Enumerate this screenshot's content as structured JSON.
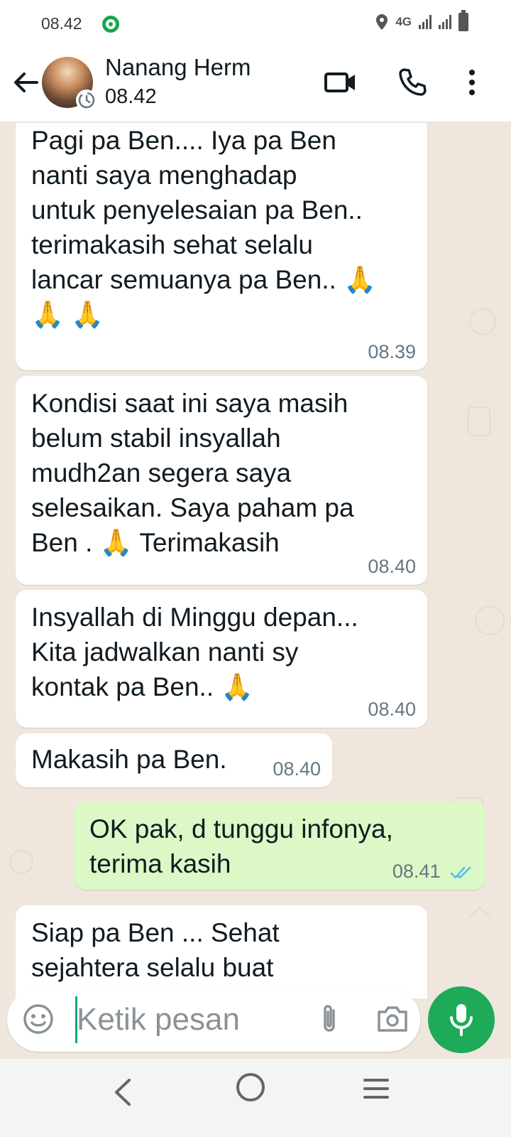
{
  "status_bar": {
    "time": "08.42",
    "network": "4G"
  },
  "header": {
    "contact_name": "Nanang Herm",
    "status": "08.42"
  },
  "messages": [
    {
      "direction": "in",
      "text": "Pagi pa Ben.... Iya pa Ben\nnanti saya menghadap\nuntuk penyelesaian pa Ben..\nterimakasih sehat selalu\nlancar semuanya pa Ben.. 🙏\n🙏 🙏",
      "time": "08.39"
    },
    {
      "direction": "in",
      "text": "Kondisi saat ini saya masih\nbelum stabil insyallah\nmudh2an segera saya\nselesaikan. Saya paham pa\nBen . 🙏 Terimakasih",
      "time": "08.40"
    },
    {
      "direction": "in",
      "text": "Insyallah di Minggu depan...\nKita jadwalkan nanti sy\nkontak pa Ben.. 🙏",
      "time": "08.40"
    },
    {
      "direction": "in",
      "text": "Makasih pa Ben.",
      "time": "08.40"
    },
    {
      "direction": "out",
      "text": "OK pak, d tunggu infonya,\nterima kasih",
      "time": "08.41",
      "status": "read"
    },
    {
      "direction": "in",
      "text": "Siap pa Ben ... Sehat\nsejahtera selalu buat",
      "time": ""
    }
  ],
  "composer": {
    "placeholder": "Ketik pesan",
    "value": ""
  },
  "colors": {
    "accent": "#1eaa58",
    "chat_background": "#efe7dd",
    "outgoing_bubble": "#dcf8c6",
    "incoming_bubble": "#ffffff",
    "read_tick": "#53bdeb"
  },
  "icons": {
    "back": "arrow-left-icon",
    "video": "video-camera-icon",
    "call": "phone-icon",
    "menu": "more-vert-icon",
    "emoji": "smiley-icon",
    "attach": "paperclip-icon",
    "camera": "camera-icon",
    "mic": "microphone-icon"
  }
}
